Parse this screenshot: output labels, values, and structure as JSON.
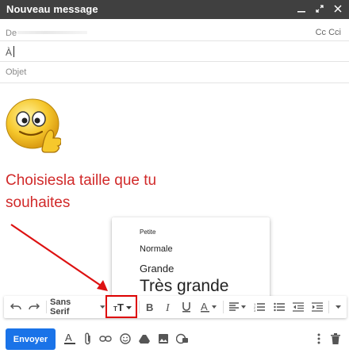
{
  "window": {
    "title": "Nouveau message"
  },
  "fields": {
    "from_label": "De",
    "cc_label": "Cc Cci",
    "to_label": "À",
    "subject_placeholder": "Objet"
  },
  "annotation": {
    "text_line1": "Choisiesla taille que tu",
    "text_line2": "souhaites"
  },
  "size_menu": {
    "options": [
      "Petite",
      "Normale",
      "Grande",
      "Très grande"
    ]
  },
  "toolbar": {
    "font_family": "Sans Serif"
  },
  "send_button": {
    "label": "Envoyer"
  },
  "colors": {
    "accent": "#1a73e8",
    "annotation": "#d12a2a",
    "titlebar": "#404040"
  },
  "icons": [
    "minimize-icon",
    "expand-icon",
    "close-icon",
    "undo-icon",
    "redo-icon",
    "text-size-icon",
    "bold-icon",
    "italic-icon",
    "underline-icon",
    "text-color-icon",
    "align-icon",
    "numbered-list-icon",
    "bulleted-list-icon",
    "indent-less-icon",
    "indent-more-icon",
    "more-options-icon",
    "format-icon",
    "attach-icon",
    "link-icon",
    "emoji-icon",
    "drive-icon",
    "photo-icon",
    "confidential-icon",
    "more-vert-icon",
    "trash-icon"
  ]
}
